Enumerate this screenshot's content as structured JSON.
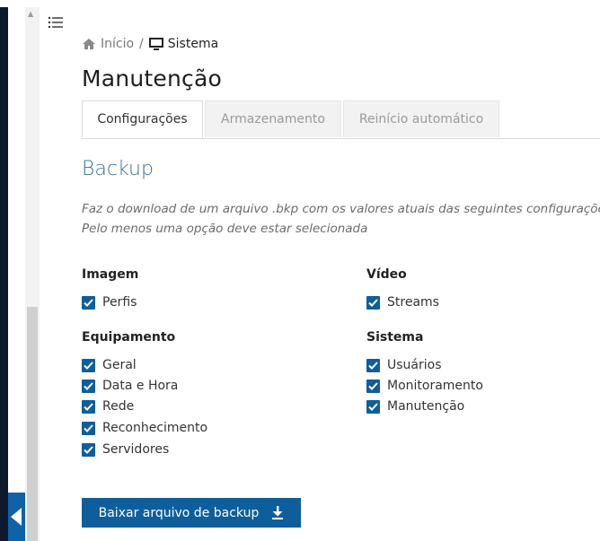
{
  "breadcrumb": {
    "home": "Início",
    "separator": "/",
    "current": "Sistema"
  },
  "page_title": "Manutenção",
  "tabs": [
    {
      "label": "Configurações",
      "active": true
    },
    {
      "label": "Armazenamento",
      "active": false
    },
    {
      "label": "Reinício automático",
      "active": false
    }
  ],
  "backup": {
    "title": "Backup",
    "description_line1": "Faz o download de um arquivo .bkp com os valores atuais das seguintes configurações",
    "description_line2": "Pelo menos uma opção deve estar selecionada",
    "groups": {
      "imagem": {
        "title": "Imagem",
        "items": [
          {
            "label": "Perfis",
            "checked": true
          }
        ]
      },
      "video": {
        "title": "Vídeo",
        "items": [
          {
            "label": "Streams",
            "checked": true
          }
        ]
      },
      "equipamento": {
        "title": "Equipamento",
        "items": [
          {
            "label": "Geral",
            "checked": true
          },
          {
            "label": "Data e Hora",
            "checked": true
          },
          {
            "label": "Rede",
            "checked": true
          },
          {
            "label": "Reconhecimento",
            "checked": true
          },
          {
            "label": "Servidores",
            "checked": true
          }
        ]
      },
      "sistema": {
        "title": "Sistema",
        "items": [
          {
            "label": "Usuários",
            "checked": true
          },
          {
            "label": "Monitoramento",
            "checked": true
          },
          {
            "label": "Manutenção",
            "checked": true
          }
        ]
      }
    },
    "download_button": "Baixar arquivo de backup"
  },
  "colors": {
    "accent": "#0f5e9c",
    "section_title": "#3b6e97",
    "sidebar": "#0d1a2e"
  },
  "icons": {
    "menu": "list-menu-icon",
    "home": "home-icon",
    "system": "monitor-icon",
    "download": "download-icon",
    "collapse": "chevron-left-icon"
  }
}
